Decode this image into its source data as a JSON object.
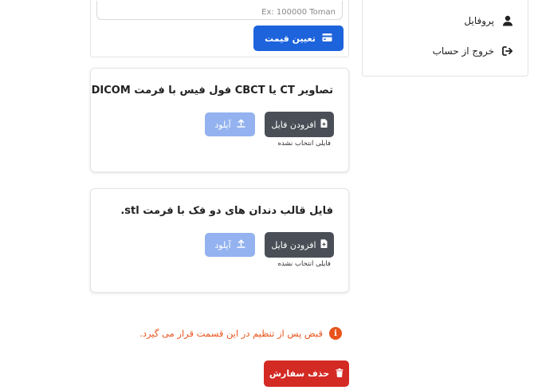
{
  "sidebar": {
    "items": [
      {
        "label": "پروفایل",
        "icon": "user-icon"
      },
      {
        "label": "خروج از حساب",
        "icon": "sign-out-icon"
      }
    ]
  },
  "price": {
    "input_placeholder": "Ex: 100000 Toman",
    "set_price_label": "تعیین قیمت",
    "set_price_icon": "credit-card-icon"
  },
  "uploads": [
    {
      "title": "تصاویر CT یا CBCT فول فیس با فرمت DICOM",
      "add_file_label": "افزودن فایل",
      "upload_label": "آپلود",
      "status": "فایلی انتخاب نشده"
    },
    {
      "title": "فایل قالب دندان های دو فک با فرمت stl.",
      "add_file_label": "افزودن فایل",
      "upload_label": "آپلود",
      "status": "فایلی انتخاب نشده"
    }
  ],
  "notice": {
    "text": "قبض پس از تنظیم در این قسمت قرار می گیرد.",
    "icon_glyph": "i",
    "color": "#e8541b"
  },
  "delete_order": {
    "label": "حذف سفارش",
    "color": "#d32a24"
  },
  "colors": {
    "primary": "#1d63dc",
    "secondary": "#4a4f57",
    "upload_disabled": "#93b2ef"
  }
}
